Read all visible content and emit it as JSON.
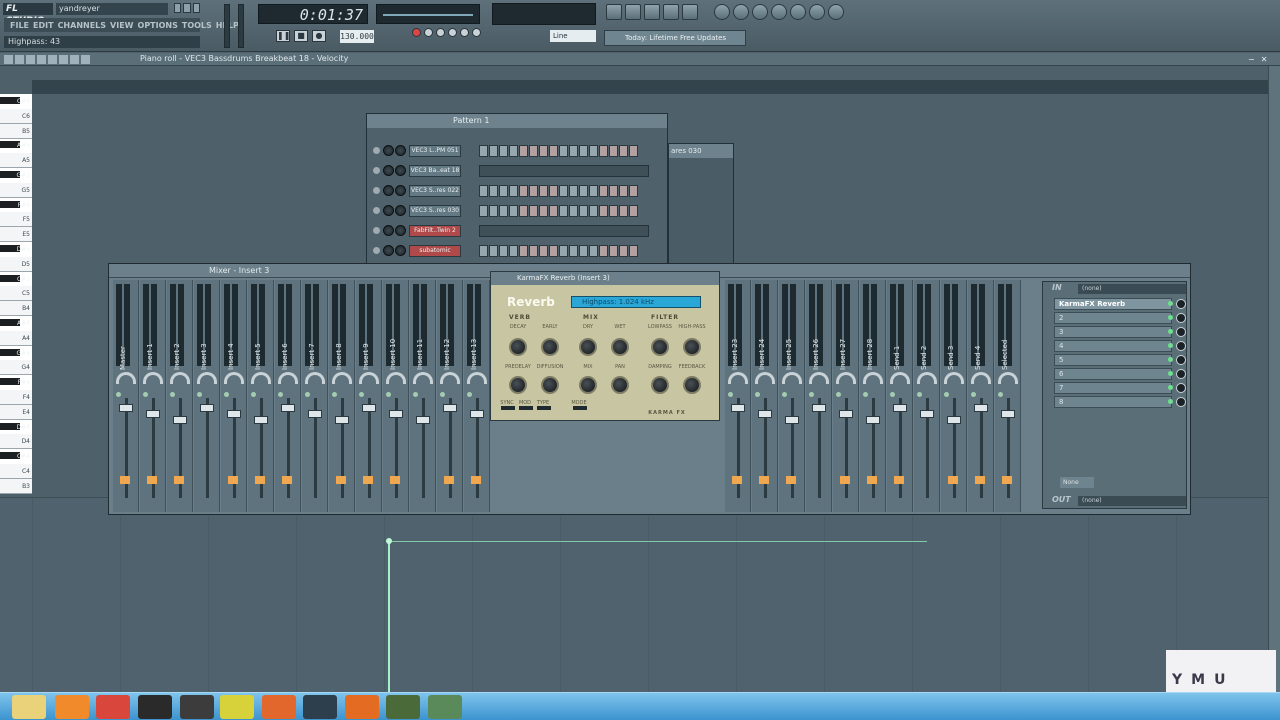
{
  "app": {
    "logo": "FL STUDIO",
    "user": "yandreyer",
    "menu": [
      "FILE",
      "EDIT",
      "CHANNELS",
      "VIEW",
      "OPTIONS",
      "TOOLS",
      "HELP"
    ],
    "hint": "Highpass: 43",
    "time": "0:01:37",
    "tempo": "130.000",
    "line_mode": "Line",
    "news": "Today: Lifetime Free Updates"
  },
  "piano_roll": {
    "title": "Piano roll - VEC3 Bassdrums Breakbeat 18 - Velocity",
    "keys": [
      "C#6",
      "C6",
      "B5",
      "A#5",
      "A5",
      "G#5",
      "G5",
      "F#5",
      "F5",
      "E5",
      "D#5",
      "D5",
      "C#5",
      "C5",
      "B4",
      "A#4",
      "A4",
      "G#4",
      "G4",
      "F#4",
      "F4",
      "E4",
      "D#4",
      "D4",
      "C#4",
      "C4",
      "B3"
    ],
    "velocity_level": 0.8
  },
  "pattern": {
    "title": "Pattern 1",
    "channels": [
      {
        "name": "VEC3 L..PM 051",
        "type": "steps",
        "red": false
      },
      {
        "name": "VEC3 Ba..eat 18",
        "type": "roll",
        "red": false
      },
      {
        "name": "VEC3 S..res 022",
        "type": "steps",
        "red": false
      },
      {
        "name": "VEC3 S..res 030",
        "type": "steps",
        "red": false
      },
      {
        "name": "FabFilt..Twin 2",
        "type": "roll",
        "red": true
      },
      {
        "name": "subatomic",
        "type": "steps",
        "red": true
      }
    ],
    "second_title": "ares 030"
  },
  "mixer": {
    "title": "Mixer - Insert 3",
    "strips": [
      "Master",
      "Insert 1",
      "Insert 2",
      "Insert 3",
      "Insert 4",
      "Insert 5",
      "Insert 6",
      "Insert 7",
      "Insert 8",
      "Insert 9",
      "Insert 10",
      "Insert 11",
      "Insert 12",
      "Insert 13"
    ],
    "strips_right": [
      "Insert 23",
      "Insert 24",
      "Insert 25",
      "Insert 26",
      "Insert 27",
      "Insert 28",
      "Send 1",
      "Send 2",
      "Send 3",
      "Send 4",
      "Selected"
    ],
    "fx_in": "IN",
    "fx_in_value": "(none)",
    "fx_out": "OUT",
    "fx_out_value": "(none)",
    "fx_slots": [
      "KarmaFX Reverb",
      "2",
      "3",
      "4",
      "5",
      "6",
      "7",
      "8"
    ],
    "eq_none": "None"
  },
  "reverb": {
    "title": "KarmaFX Reverb (Insert 3)",
    "name": "Reverb",
    "display": "Highpass: 1.024 kHz",
    "sections": [
      "VERB",
      "MIX",
      "FILTER"
    ],
    "labels_top": [
      "DECAY",
      "EARLY",
      "DRY",
      "WET",
      "LOWPASS",
      "HIGH-PASS"
    ],
    "labels_bottom": [
      "PREDELAY",
      "DIFFUSION",
      "MIX",
      "PAN",
      "DAMPING",
      "FEEDBACK"
    ],
    "labels_small": [
      "SYNC",
      "MOD",
      "TYPE",
      "MODE"
    ],
    "brand": "KARMA FX"
  },
  "watermark": "YMU"
}
